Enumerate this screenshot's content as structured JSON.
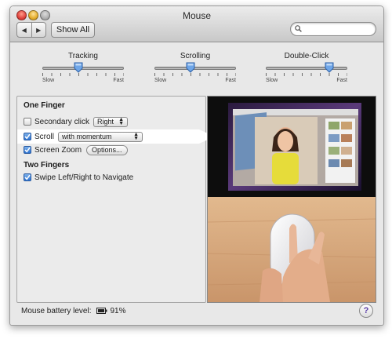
{
  "window": {
    "title": "Mouse"
  },
  "toolbar": {
    "show_all_label": "Show All",
    "search_placeholder": "",
    "search_value": ""
  },
  "sliders": [
    {
      "label": "Tracking",
      "min_label": "Slow",
      "max_label": "Fast",
      "value": 0.44
    },
    {
      "label": "Scrolling",
      "min_label": "Slow",
      "max_label": "Fast",
      "value": 0.44
    },
    {
      "label": "Double-Click",
      "min_label": "Slow",
      "max_label": "Fast",
      "value": 0.78
    }
  ],
  "one_finger": {
    "title": "One Finger",
    "secondary_click": {
      "label": "Secondary click",
      "checked": false,
      "option": "Right"
    },
    "scroll": {
      "label": "Scroll",
      "checked": true,
      "option": "with momentum"
    },
    "screen_zoom": {
      "label": "Screen Zoom",
      "checked": true,
      "options_label": "Options..."
    }
  },
  "two_fingers": {
    "title": "Two Fingers",
    "swipe": {
      "label": "Swipe Left/Right to Navigate",
      "checked": true
    }
  },
  "status": {
    "battery_label": "Mouse battery level:",
    "battery_value": "91%"
  },
  "help_label": "?",
  "icons": {
    "back": "back-arrow-icon",
    "forward": "forward-arrow-icon",
    "search": "magnifier-icon",
    "battery": "battery-icon",
    "help": "question-mark-icon"
  },
  "colors": {
    "checkbox_blue": "#2a71d0",
    "help_purple": "#5b3ea8"
  }
}
